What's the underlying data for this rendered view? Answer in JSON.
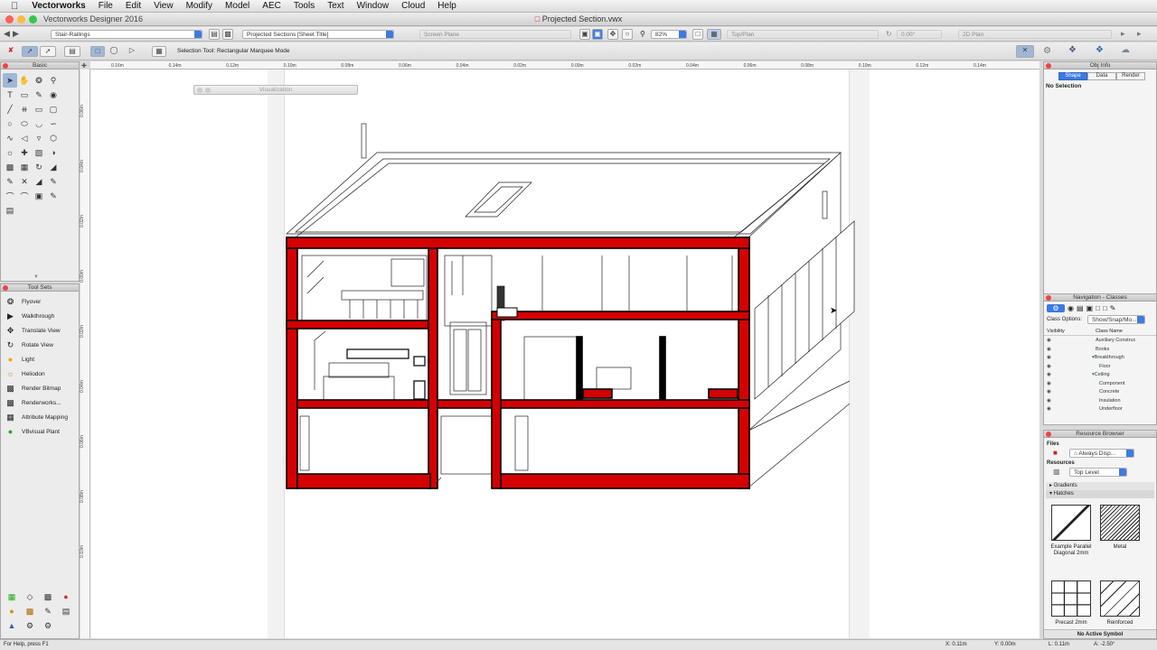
{
  "menubar": {
    "app_name": "Vectorworks",
    "items": [
      "File",
      "Edit",
      "View",
      "Modify",
      "Model",
      "AEC",
      "Tools",
      "Text",
      "Window",
      "Cloud",
      "Help"
    ]
  },
  "window": {
    "app_title": "Vectorworks Designer 2016",
    "doc_title": "Projected Section.vwx"
  },
  "view_bar": {
    "class_dropdown": "Stair-Railings",
    "layer_dropdown": "Projected Sections [Sheet Title]",
    "plane_dropdown": "Screen Plane",
    "zoom": "82%",
    "view_dropdown": "Top/Plan",
    "rotation": "0.00°",
    "render_dropdown": "2D Plan"
  },
  "mode_bar": {
    "message": "Selection Tool: Rectangular Marquee Mode"
  },
  "rulers": {
    "top": [
      "0.16m",
      "0.14m",
      "0.12m",
      "0.10m",
      "0.08m",
      "0.06m",
      "0.04m",
      "0.02m",
      "0.00m",
      "0.02m",
      "0.04m",
      "0.06m",
      "0.08m",
      "0.10m",
      "0.12m",
      "0.14m"
    ],
    "left": [
      "0.06m",
      "0.04m",
      "0.02m",
      "0.00m",
      "0.02m",
      "0.04m",
      "0.06m",
      "0.08m",
      "0.10m"
    ]
  },
  "floating_palette": {
    "title": "Visualization"
  },
  "basic_palette": {
    "title": "Basic"
  },
  "tool_sets": {
    "title": "Tool Sets",
    "items": [
      {
        "label": "Flyover",
        "icon": "flyover-icon"
      },
      {
        "label": "Walkthrough",
        "icon": "walkthrough-icon"
      },
      {
        "label": "Translate View",
        "icon": "translate-view-icon"
      },
      {
        "label": "Rotate View",
        "icon": "rotate-view-icon"
      },
      {
        "label": "Light",
        "icon": "light-bulb-icon"
      },
      {
        "label": "Heliodon",
        "icon": "heliodon-icon"
      },
      {
        "label": "Render Bitmap",
        "icon": "render-bitmap-icon"
      },
      {
        "label": "Renderworks...",
        "icon": "renderworks-icon"
      },
      {
        "label": "Attribute Mapping",
        "icon": "attribute-mapping-icon"
      },
      {
        "label": "VBvisual Plant",
        "icon": "plant-icon"
      }
    ]
  },
  "obj_info": {
    "title": "Obj Info",
    "tabs": [
      "Shape",
      "Data",
      "Render"
    ],
    "selection": "No Selection"
  },
  "navigation": {
    "title": "Navigation - Classes",
    "class_options_label": "Class Options:",
    "class_options_value": "Show/Snap/Mo...",
    "col_visibility": "Visibility",
    "col_class_name": "Class Name",
    "classes": [
      "Auxiliary Construc",
      "Books",
      "Breakthrough",
      "Floor",
      "Ceiling",
      "Component",
      "Concrete",
      "Insulation",
      "Underfloor"
    ]
  },
  "resource_browser": {
    "title": "Resource Browser",
    "files_label": "Files",
    "files_value": "Always Disp...",
    "resources_label": "Resources",
    "resources_value": "Top Level",
    "folders": [
      "Gradients",
      "Hatches"
    ],
    "hatches": [
      "Example Parallel Diagonal 2mm",
      "Metal",
      "Precast 2mm",
      "Reinforced"
    ],
    "active_symbol": "No Active Symbol"
  },
  "status": {
    "help": "For Help, press F1",
    "x": "X: 0.11m",
    "y": "Y: 0.00m",
    "l": "L: 0.11m",
    "a": "A: -2.50°"
  },
  "colors": {
    "section_fill": "#d40000",
    "accent": "#3d7be0"
  }
}
